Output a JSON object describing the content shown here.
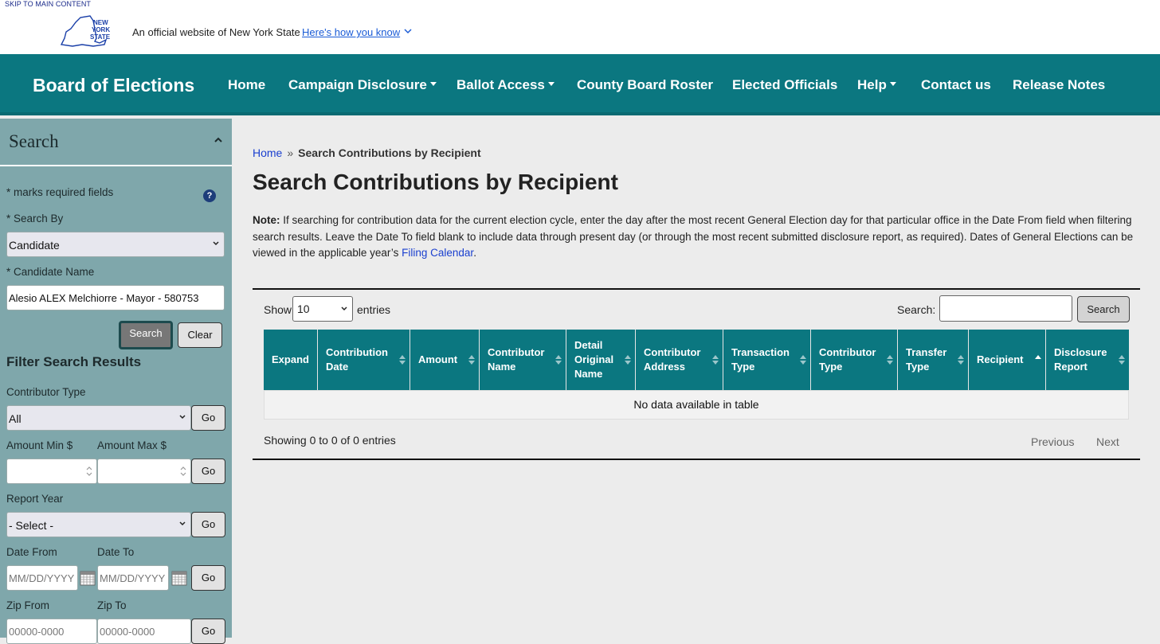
{
  "skip_link": "SKIP TO MAIN CONTENT",
  "official_text": "An official website of New York State",
  "how_you_know": "Here's how you know",
  "logo_text": {
    "line1": "NEW",
    "line2": "YORK",
    "line3": "STATE"
  },
  "brand": "Board of Elections",
  "nav": {
    "home": "Home",
    "campaign": "Campaign Disclosure",
    "ballot": "Ballot Access",
    "roster": "County Board Roster",
    "elected": "Elected Officials",
    "help": "Help",
    "contact": "Contact us",
    "release": "Release Notes"
  },
  "sidebar": {
    "title": "Search",
    "required_note": "* marks required fields",
    "help_glyph": "?",
    "search_by_label": "* Search By",
    "search_by_value": "Candidate",
    "candidate_label": "* Candidate Name",
    "candidate_value": "Alesio ALEX Melchiorre - Mayor - 580753",
    "search_btn": "Search",
    "clear_btn": "Clear",
    "filter_title": "Filter Search Results",
    "contributor_type_label": "Contributor Type",
    "contributor_type_value": "All",
    "go": "Go",
    "amount_min_label": "Amount Min $",
    "amount_max_label": "Amount Max $",
    "report_year_label": "Report Year",
    "report_year_value": "- Select -",
    "date_from_label": "Date From",
    "date_to_label": "Date To",
    "date_placeholder": "MM/DD/YYYY",
    "zip_from_label": "Zip From",
    "zip_to_label": "Zip To",
    "zip_placeholder": "00000-0000"
  },
  "main": {
    "breadcrumb_home": "Home",
    "breadcrumb_sep": "»",
    "breadcrumb_current": "Search Contributions by Recipient",
    "title": "Search Contributions by Recipient",
    "note_label": "Note:",
    "note_text": " If searching for contribution data for the current election cycle, enter the day after the most recent General Election day for that particular office in the Date From field when filtering search results. Leave the Date To field blank to include data through present day (or through the most recent submitted disclosure report, as required). Dates of General Elections can be viewed in the applicable year’s ",
    "note_link": "Filing Calendar",
    "note_end": ".",
    "show_label": "Show",
    "entries_value": "10",
    "entries_label": "entries",
    "search_label": "Search:",
    "search_btn": "Search",
    "columns": [
      "Expand",
      "Contribution Date",
      "Amount",
      "Contributor Name",
      "Detail Original Name",
      "Contributor Address",
      "Transaction Type",
      "Contributor Type",
      "Transfer Type",
      "Recipient",
      "Disclosure Report"
    ],
    "empty_text": "No data available in table",
    "info_text": "Showing 0 to 0 of 0 entries",
    "previous": "Previous",
    "next": "Next"
  }
}
